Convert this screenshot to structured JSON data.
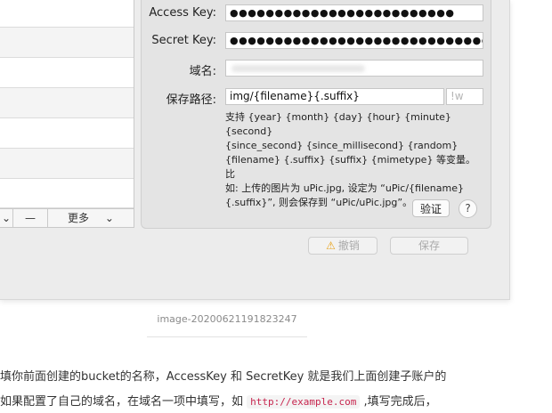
{
  "window": {
    "bottombar": {
      "minus_label": "—",
      "more_label": "更多"
    }
  },
  "form": {
    "access_key": {
      "label": "Access Key:",
      "value": "●●●●●●●●●●●●●●●●●●●●●●●●●"
    },
    "secret_key": {
      "label": "Secret Key:",
      "value": "●●●●●●●●●●●●●●●●●●●●●●●●●●●●●●"
    },
    "domain": {
      "label": "域名:",
      "value": ""
    },
    "save_path": {
      "label": "保存路径:",
      "value": "img/{filename}{.suffix}",
      "suffix_placeholder": "!w"
    },
    "hint_lines": [
      "支持 {year} {month} {day} {hour} {minute} {second}",
      "{since_second} {since_millisecond} {random}",
      "{filename} {.suffix} {suffix} {mimetype} 等变量。比",
      "如: 上传的图片为 uPic.jpg, 设定为 “uPic/{filename}",
      "{.suffix}”, 则会保存到 “uPic/uPic.jpg”。"
    ],
    "verify_label": "验证",
    "help_label": "?",
    "cancel_label": "撤销",
    "save_label": "保存"
  },
  "article": {
    "caption": "image-20200621191823247",
    "line1": "填你前面创建的bucket的名称，AccessKey 和 SecretKey 就是我们上面创建子账户的",
    "line2_before": "如果配置了自己的域名，在域名一项中填写，如 ",
    "line2_code": "http://example.com",
    "line2_after": " ,填写完成后，"
  },
  "colors": {
    "warning": "#e8a21a",
    "code_text": "#c7254e"
  }
}
